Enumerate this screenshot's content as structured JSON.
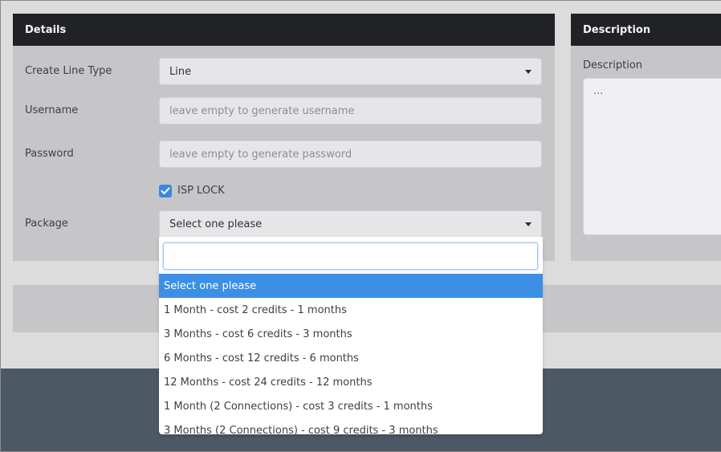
{
  "details": {
    "title": "Details",
    "line_type": {
      "label": "Create Line Type",
      "value": "Line"
    },
    "username": {
      "label": "Username",
      "placeholder": "leave empty to generate username"
    },
    "password": {
      "label": "Password",
      "placeholder": "leave empty to generate password"
    },
    "isp_lock": {
      "label": "ISP LOCK",
      "checked": true
    },
    "package": {
      "label": "Package",
      "value": "Select one please"
    }
  },
  "description": {
    "title": "Description",
    "label": "Description",
    "placeholder": "..."
  },
  "package_dropdown": {
    "search_value": "",
    "options": [
      "Select one please",
      "1 Month - cost 2 credits - 1 months",
      "3 Months - cost 6 credits - 3 months",
      "6 Months - cost 12 credits - 6 months",
      "12 Months - cost 24 credits - 12 months",
      "1 Month (2 Connections) - cost 3 credits - 1 months",
      "3 Months (2 Connections) - cost 9 credits - 3 months"
    ],
    "highlighted_index": 0
  },
  "colors": {
    "accent": "#3b8fe5",
    "header_bg": "#202226",
    "footer_bg": "#4c5864"
  }
}
